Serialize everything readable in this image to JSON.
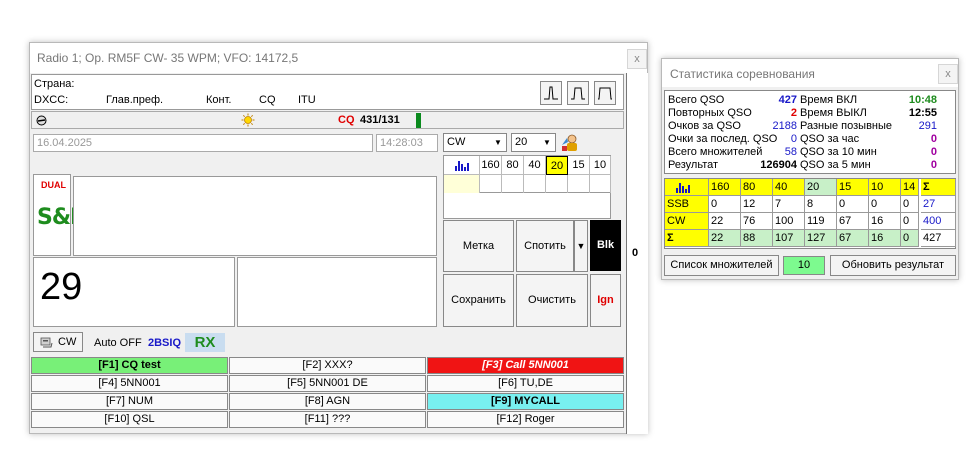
{
  "radio": {
    "title": "Radio 1; Op. RM5F CW- 35 WPM; VFO: 14172,5",
    "close": "x",
    "right_zero": "0",
    "info": {
      "country_label": "Страна:",
      "dxcc_label": "DXCC:",
      "prefix_label": "Глав.преф.",
      "continent_label": "Конт.",
      "cq_label": "CQ",
      "itu_label": "ITU"
    },
    "status": {
      "cq": "CQ",
      "count": "431/131"
    },
    "date": "16.04.2025",
    "time": "14:28:03",
    "mode_select": "CW",
    "band_select": "20",
    "bands": [
      "160",
      "80",
      "40",
      "20",
      "15",
      "10"
    ],
    "active_band": "20",
    "dual_label": "DUAL",
    "sp_label": "S&P",
    "number_value": "29",
    "buttons": {
      "mark": "Метка",
      "spot": "Спотить",
      "blk": "Blk",
      "save": "Сохранить",
      "clear": "Очистить",
      "ign": "Ign",
      "spot_arrow": "▼"
    },
    "mode_row": {
      "cw": "CW",
      "auto_off": "Auto OFF",
      "callsign": "2BSIQ",
      "rx": "RX"
    },
    "fkeys": [
      {
        "label": "[F1] CQ test",
        "bg": "#78f078",
        "fg": "#000000"
      },
      {
        "label": "[F2] XXX?",
        "bg": "#fafafa",
        "fg": "#000000"
      },
      {
        "label": "[F3] Call 5NN001",
        "bg": "#f01414",
        "fg": "#ffffff"
      },
      {
        "label": "[F4] 5NN001",
        "bg": "#fafafa",
        "fg": "#000000"
      },
      {
        "label": "[F5] 5NN001 DE",
        "bg": "#fafafa",
        "fg": "#000000"
      },
      {
        "label": "[F6] TU,DE",
        "bg": "#fafafa",
        "fg": "#000000"
      },
      {
        "label": "[F7] NUM",
        "bg": "#fafafa",
        "fg": "#000000"
      },
      {
        "label": "[F8] AGN",
        "bg": "#fafafa",
        "fg": "#000000"
      },
      {
        "label": "[F9] MYCALL",
        "bg": "#78f0f0",
        "fg": "#000000"
      },
      {
        "label": "[F10] QSL",
        "bg": "#fafafa",
        "fg": "#000000"
      },
      {
        "label": "[F11] ???",
        "bg": "#fafafa",
        "fg": "#000000"
      },
      {
        "label": "[F12] Roger",
        "bg": "#fafafa",
        "fg": "#000000"
      }
    ]
  },
  "stats": {
    "title": "Статистика соревнования",
    "close": "x",
    "left": [
      {
        "label": "Всего QSO",
        "value": "427",
        "color": "#1818c8"
      },
      {
        "label": "Повторных QSO",
        "value": "2",
        "color": "#e00000"
      },
      {
        "label": "Очков за QSO",
        "value": "2188",
        "color": "#1818c8"
      },
      {
        "label": "Очки за послед. QSO",
        "value": "0",
        "color": "#1818c8"
      },
      {
        "label": "Всего множителей",
        "value": "58",
        "color": "#1818c8"
      },
      {
        "label": "Результат",
        "value": "126904",
        "color": "#000000"
      }
    ],
    "right": [
      {
        "label": "Время ВКЛ",
        "value": "10:48",
        "color": "#1e8c1e"
      },
      {
        "label": "Время ВЫКЛ",
        "value": "12:55",
        "color": "#000000"
      },
      {
        "label": "Разные позывные",
        "value": "291",
        "color": "#1818c8"
      },
      {
        "label": "QSO за час",
        "value": "0",
        "color": "#a000a0"
      },
      {
        "label": "QSO за 10 мин",
        "value": "0",
        "color": "#a000a0"
      },
      {
        "label": "QSO за 5 мин",
        "value": "0",
        "color": "#a000a0"
      }
    ],
    "table": {
      "headers": [
        "160",
        "80",
        "40",
        "20",
        "15",
        "10",
        "14"
      ],
      "sigma": "Σ",
      "rows": [
        {
          "mode": "SSB",
          "cells": [
            "0",
            "12",
            "7",
            "8",
            "0",
            "0",
            "0"
          ],
          "total": "27"
        },
        {
          "mode": "CW",
          "cells": [
            "22",
            "76",
            "100",
            "119",
            "67",
            "16",
            "0"
          ],
          "total": "400"
        },
        {
          "mode": "Σ",
          "cells": [
            "22",
            "88",
            "107",
            "127",
            "67",
            "16",
            "0"
          ],
          "total": "427"
        }
      ]
    },
    "mult_list_btn": "Список множителей",
    "mult_count": "10",
    "update_btn": "Обновить результат"
  }
}
